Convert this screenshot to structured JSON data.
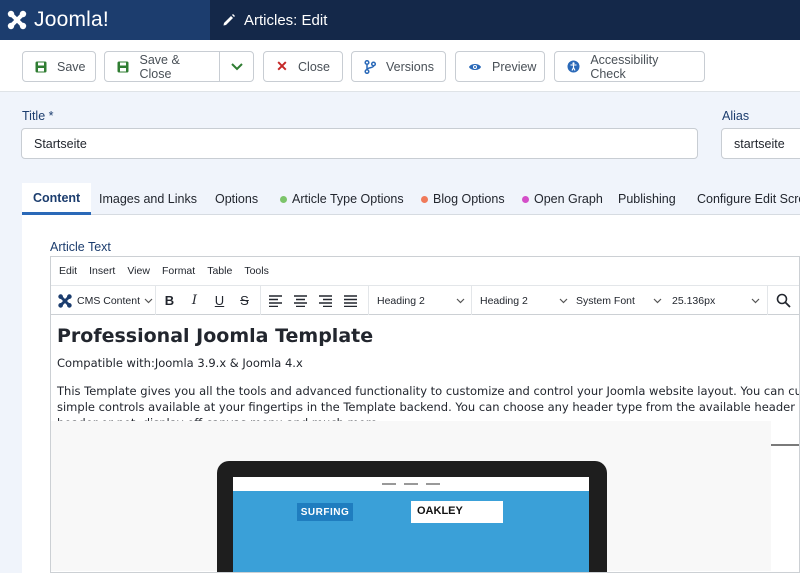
{
  "header": {
    "logo": "Joomla!",
    "title": "Articles: Edit"
  },
  "toolbar": {
    "save": "Save",
    "save_close": "Save & Close",
    "close": "Close",
    "versions": "Versions",
    "preview": "Preview",
    "accessibility": "Accessibility Check"
  },
  "form": {
    "title_label": "Title *",
    "title_value": "Startseite",
    "alias_label": "Alias",
    "alias_value": "startseite"
  },
  "tabs": [
    {
      "label": "Content"
    },
    {
      "label": "Images and Links"
    },
    {
      "label": "Options"
    },
    {
      "label": "Article Type Options",
      "dot_color": "#7cc46a"
    },
    {
      "label": "Blog Options",
      "dot_color": "#f07a5a"
    },
    {
      "label": "Open Graph",
      "dot_color": "#d44ec8"
    },
    {
      "label": "Publishing"
    },
    {
      "label": "Configure Edit Scre"
    }
  ],
  "editor": {
    "label": "Article Text",
    "menu": [
      "Edit",
      "Insert",
      "View",
      "Format",
      "Table",
      "Tools"
    ],
    "cms_content": "CMS Content",
    "block_format": "Heading 2",
    "style_format": "Heading 2",
    "font_family": "System Font",
    "font_size": "25.136px",
    "content": {
      "heading": "Professional Joomla Template",
      "compat": "Compatible with:Joomla 3.9.x & Joomla 4.x",
      "para_line1": "This Template gives you all the tools and advanced functionality to customize and control your Joomla website layout. You can customize the a",
      "para_line2": "simple controls available at your fingertips in the Template backend. You can choose any header type from the available header variations. Dec",
      "para_line3": "header or not, display off canvas menu and much more."
    },
    "preview_image": {
      "brand1": "SURFING",
      "brand2": "OAKLEY"
    }
  }
}
